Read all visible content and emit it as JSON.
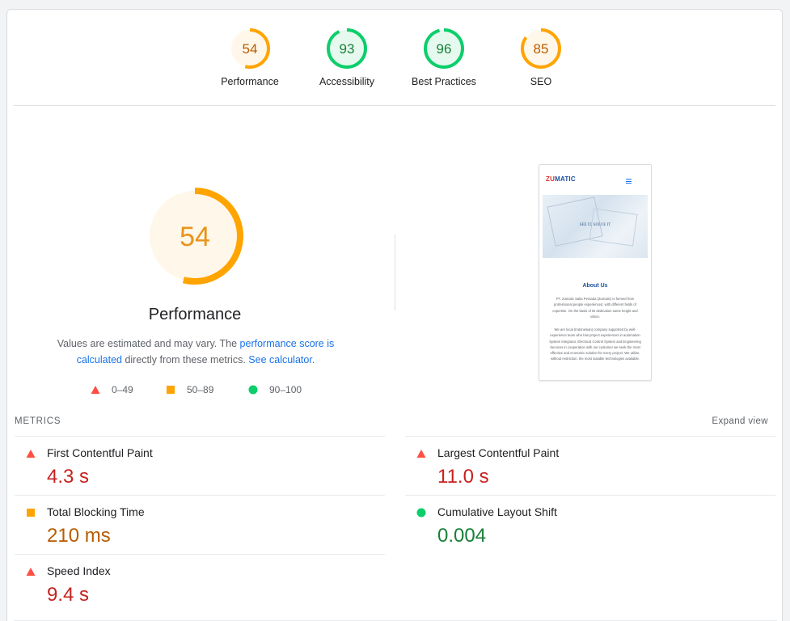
{
  "colors": {
    "fail": "#ff4e42",
    "average": "#ffa400",
    "pass": "#0cce6b",
    "fail_text": "#c5221f",
    "average_text": "#b85c00",
    "pass_text": "#188038"
  },
  "summary": [
    {
      "score": 54,
      "label": "Performance",
      "rating": "average"
    },
    {
      "score": 93,
      "label": "Accessibility",
      "rating": "pass"
    },
    {
      "score": 96,
      "label": "Best Practices",
      "rating": "pass"
    },
    {
      "score": 85,
      "label": "SEO",
      "rating": "average"
    }
  ],
  "performance": {
    "score": "54",
    "title": "Performance",
    "desc_before": "Values are estimated and may vary. The ",
    "desc_link1": "performance score is calculated",
    "desc_middle": " directly from these metrics. ",
    "desc_link2": "See calculator",
    "desc_after": "."
  },
  "legend": [
    {
      "range": "0–49",
      "shape": "triangle-icon"
    },
    {
      "range": "50–89",
      "shape": "square-icon"
    },
    {
      "range": "90–100",
      "shape": "circle-icon"
    }
  ],
  "preview": {
    "logo_first": "ZU",
    "logo_rest": "MATIC",
    "hero_text": "SEE IT, SOLVE IT",
    "about_title": "About Us",
    "para1": "PT. Zumatic Saka Persada (Zumatic) is formed from professional people experienced, with different fields of expertise. On the basis of its dedication same height and vision.",
    "para2": "We are local (Indonesian) company supported by well-experience team who has project experiences in automation System Integrator, Electrical Control System and Engineering Services in cooperation with our customer we seek the most effective and economic solution for every project. We utilize, without restriction, the most suitable technologies available."
  },
  "metrics": {
    "header": "METRICS",
    "expand": "Expand view",
    "items": [
      {
        "label": "First Contentful Paint",
        "value": "4.3 s",
        "rating": "fail"
      },
      {
        "label": "Largest Contentful Paint",
        "value": "11.0 s",
        "rating": "fail"
      },
      {
        "label": "Total Blocking Time",
        "value": "210 ms",
        "rating": "average"
      },
      {
        "label": "Cumulative Layout Shift",
        "value": "0.004",
        "rating": "pass"
      },
      {
        "label": "Speed Index",
        "value": "9.4 s",
        "rating": "fail"
      }
    ]
  }
}
